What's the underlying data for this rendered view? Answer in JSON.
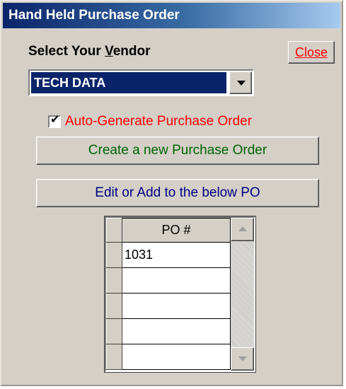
{
  "window": {
    "title": "Hand Held Purchase Order"
  },
  "vendor": {
    "label_pre": "Select Your ",
    "label_accel": "V",
    "label_post": "endor",
    "selected": "TECH DATA"
  },
  "close_label": "Close",
  "auto_generate": {
    "checked": true,
    "label": "Auto-Generate Purchase Order"
  },
  "buttons": {
    "create": "Create a new Purchase Order",
    "edit": "Edit or Add to the below PO"
  },
  "po_grid": {
    "header": "PO #",
    "rows": [
      "1031",
      "",
      "",
      "",
      ""
    ]
  },
  "colors": {
    "selection": "#0a246a",
    "close_text": "#ff0000",
    "auto_label": "#ff0000",
    "create_text": "#006400",
    "edit_text": "#000080"
  },
  "icons": {
    "checkmark": "checkmark-icon",
    "dropdown": "chevron-down-icon",
    "scroll_up": "scroll-up-arrow-icon",
    "scroll_down": "scroll-down-arrow-icon"
  }
}
